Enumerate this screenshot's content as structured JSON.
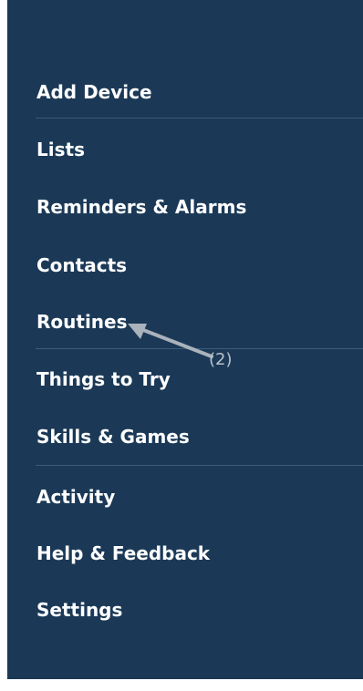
{
  "menu": {
    "items": [
      {
        "label": "Add Device"
      },
      {
        "label": "Lists"
      },
      {
        "label": "Reminders & Alarms"
      },
      {
        "label": "Contacts"
      },
      {
        "label": "Routines"
      },
      {
        "label": "Things to Try"
      },
      {
        "label": "Skills & Games"
      },
      {
        "label": "Activity"
      },
      {
        "label": "Help & Feedback"
      },
      {
        "label": "Settings"
      }
    ]
  },
  "annotation": {
    "label": "(2)"
  },
  "colors": {
    "background": "#1b3957",
    "text": "#ffffff",
    "divider": "#3d5a78",
    "annotation": "#b9c2cc"
  }
}
